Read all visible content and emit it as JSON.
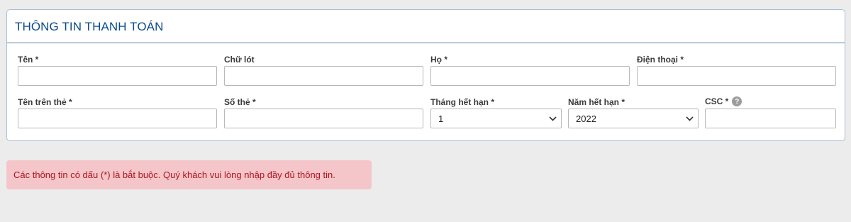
{
  "panel": {
    "title": "THÔNG TIN THANH TOÁN"
  },
  "fields": {
    "first_name": {
      "label": "Tên *",
      "value": ""
    },
    "middle_name": {
      "label": "Chữ lót",
      "value": ""
    },
    "last_name": {
      "label": "Họ *",
      "value": ""
    },
    "phone": {
      "label": "Điện thoại *",
      "value": ""
    },
    "card_name": {
      "label": "Tên trên thẻ *",
      "value": ""
    },
    "card_number": {
      "label": "Số thẻ *",
      "value": ""
    },
    "exp_month": {
      "label": "Tháng hết hạn *",
      "selected": "1"
    },
    "exp_year": {
      "label": "Năm hết hạn *",
      "selected": "2022"
    },
    "csc": {
      "label": "CSC *",
      "value": "",
      "help_icon": "question-mark"
    }
  },
  "alert": {
    "message": "Các thông tin có dấu (*) là bắt buộc. Quý khách vui lòng nhập đầy đủ thông tin.",
    "color": "#b0121f",
    "background": "#f4c6c9"
  },
  "colors": {
    "title": "#0d4b8c",
    "header_rule": "#5a82ad"
  }
}
